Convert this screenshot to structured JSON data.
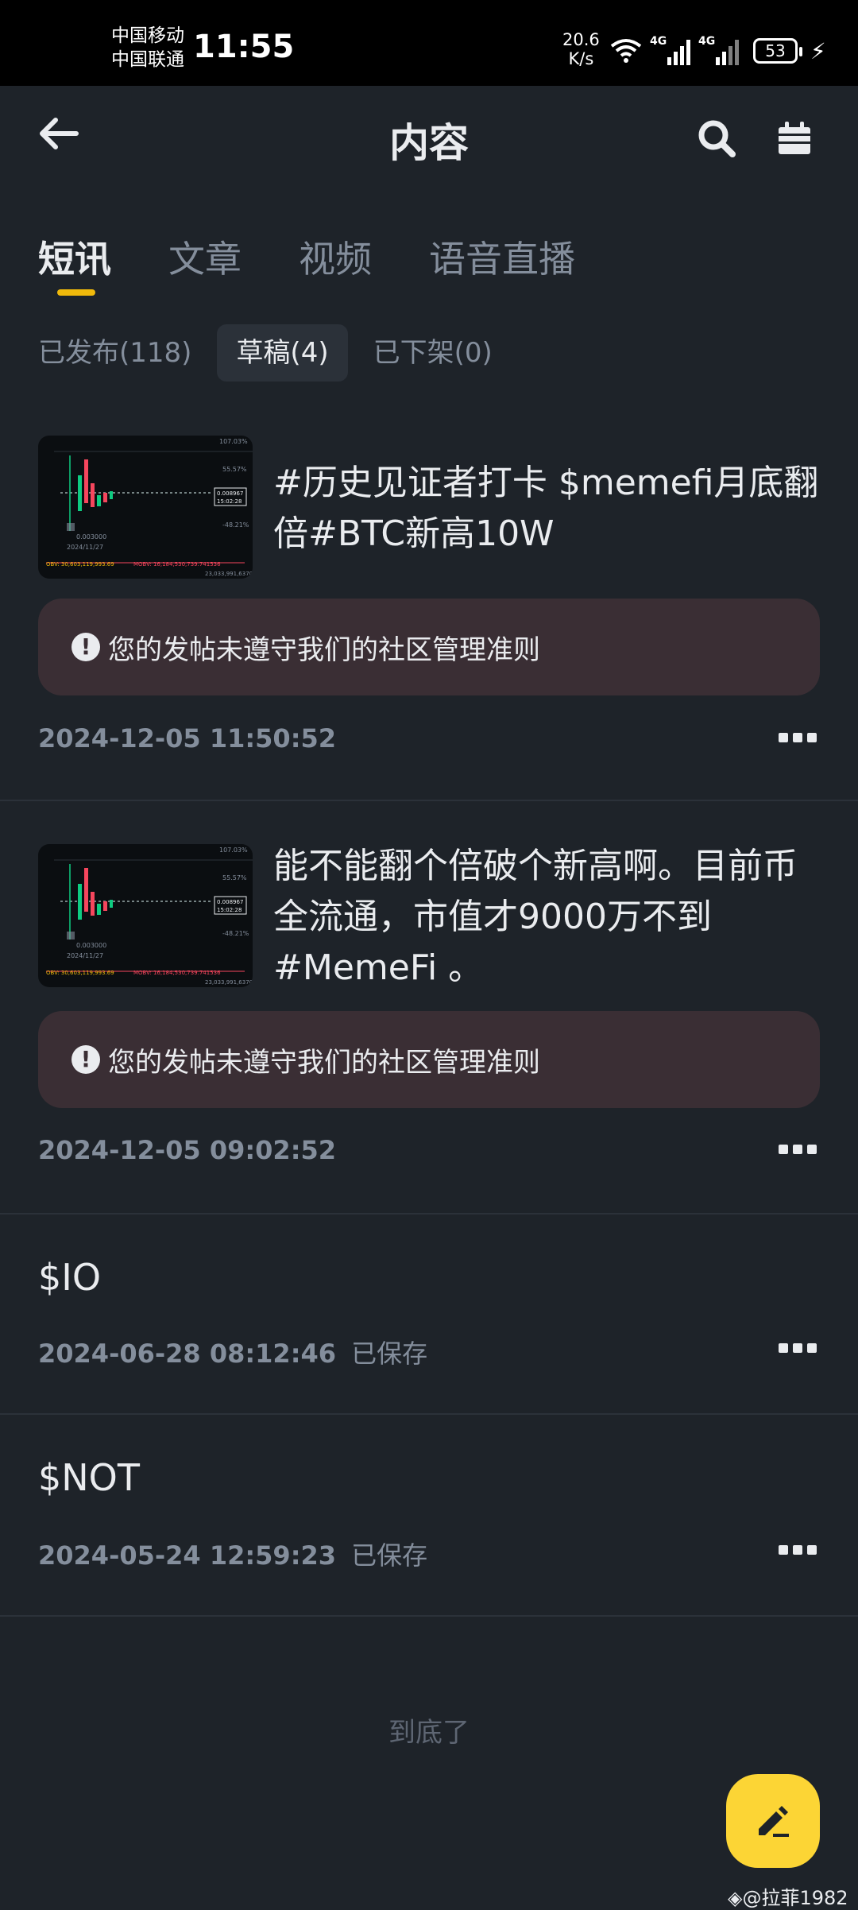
{
  "status_bar": {
    "carrier_1": "中国移动",
    "carrier_2": "中国联通",
    "time": "11:55",
    "net_speed_value": "20.6",
    "net_speed_unit": "K/s",
    "network_type_1": "4G",
    "network_type_2": "4G",
    "battery": "53"
  },
  "header": {
    "title": "内容"
  },
  "tabs": [
    {
      "label": "短讯",
      "active": true
    },
    {
      "label": "文章",
      "active": false
    },
    {
      "label": "视频",
      "active": false
    },
    {
      "label": "语音直播",
      "active": false
    }
  ],
  "subtabs": [
    {
      "label": "已发布(118)",
      "active": false
    },
    {
      "label": "草稿(4)",
      "active": true
    },
    {
      "label": "已下架(0)",
      "active": false
    }
  ],
  "posts": [
    {
      "text": "#历史见证者打卡 $memefi月底翻倍#BTC新高10W",
      "warning": "您的发帖未遵守我们的社区管理准则",
      "timestamp": "2024-12-05 11:50:52",
      "status": ""
    },
    {
      "text": "能不能翻个倍破个新高啊。目前币全流通，市值才9000万不到#MemeFi 。",
      "warning": "您的发帖未遵守我们的社区管理准则",
      "timestamp": "2024-12-05 09:02:52",
      "status": ""
    },
    {
      "text": "$IO",
      "timestamp": "2024-06-28 08:12:46",
      "status": "已保存"
    },
    {
      "text": "$NOT",
      "timestamp": "2024-05-24 12:59:23",
      "status": "已保存"
    }
  ],
  "thumbnail": {
    "labels": [
      "107.03%",
      "55.57%",
      "0.008967",
      "15:02:28",
      "-48.21%",
      "0.003000",
      "2024/11/27",
      "OBV: 30,603,119,993.69",
      "MOBV: 16,184,530,739.741536",
      "23,033,991,637091"
    ]
  },
  "footer": {
    "end_text": "到底了",
    "watermark": "@拉菲1982"
  },
  "colors": {
    "background": "#1E2329",
    "accent": "#F0B90B",
    "fab": "#FCD535",
    "warning_bg": "#3A2E34",
    "muted_text": "#848E9C"
  },
  "icons": [
    "back-arrow-icon",
    "search-icon",
    "calendar-icon",
    "warning-icon",
    "more-icon",
    "edit-icon",
    "binance-logo-icon"
  ]
}
